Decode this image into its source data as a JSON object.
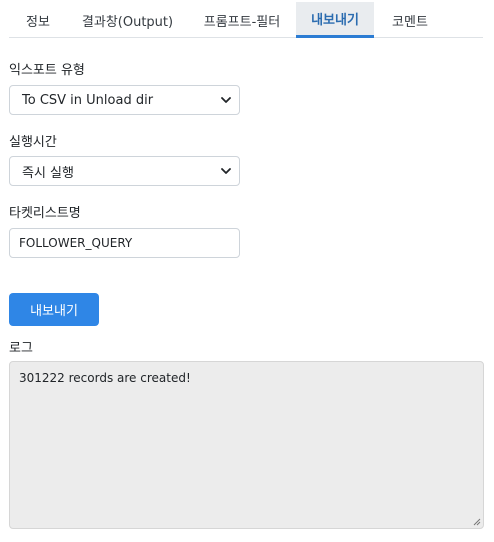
{
  "tabs": [
    {
      "label": "정보"
    },
    {
      "label": "결과창(Output)"
    },
    {
      "label": "프롬프트-필터"
    },
    {
      "label": "내보내기"
    },
    {
      "label": "코멘트"
    }
  ],
  "active_tab": "내보내기",
  "export_type": {
    "label": "익스포트 유형",
    "value": "To CSV in Unload dir"
  },
  "run_time": {
    "label": "실행시간",
    "value": "즉시 실행"
  },
  "target_list": {
    "label": "타켓리스트명",
    "value": "FOLLOWER_QUERY"
  },
  "export_button": {
    "label": "내보내기"
  },
  "log": {
    "label": "로그",
    "text": "301222 records are created!"
  },
  "colors": {
    "accent": "#2f86e6",
    "active_tab_text": "#2b6cb0",
    "log_bg": "#ececec"
  }
}
